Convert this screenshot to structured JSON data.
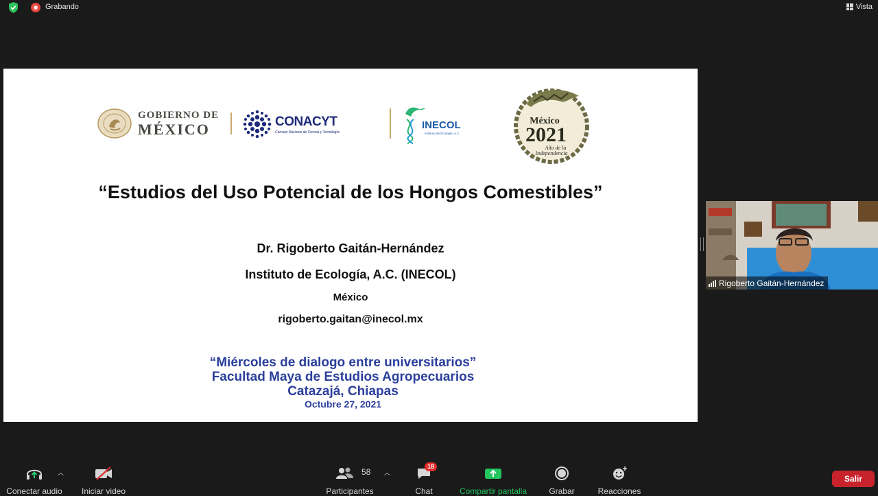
{
  "topbar": {
    "recording_label": "Grabando",
    "view_label": "Vista"
  },
  "slide": {
    "logos": {
      "gob_line1": "GOBIERNO DE",
      "gob_line2": "MÉXICO",
      "conacyt_name": "CONACYT",
      "conacyt_sub": "Consejo Nacional de Ciencia y Tecnología",
      "inecol_name": "INECOL",
      "inecol_sub": "Instituto de Ecología, A.C.",
      "mexico_2021_top": "México",
      "mexico_2021_year": "2021",
      "mexico_2021_sub1": "Año de la",
      "mexico_2021_sub2": "Independencia"
    },
    "title": "“Estudios del Uso Potencial de los Hongos Comestibles”",
    "author": "Dr. Rigoberto Gaitán-Hernández",
    "institution": "Instituto de Ecología, A.C. (INECOL)",
    "country": "México",
    "email": "rigoberto.gaitan@inecol.mx",
    "event_line1": "“Miércoles de dialogo entre universitarios”",
    "event_line2": "Facultad Maya de Estudios Agropecuarios",
    "event_line3": "Catazajá, Chiapas",
    "event_date": "Octubre 27, 2021"
  },
  "participant_video": {
    "name": "Rigoberto Gaitán-Hernández"
  },
  "toolbar": {
    "audio_label": "Conectar audio",
    "video_label": "Iniciar video",
    "participants_label": "Participantes",
    "participants_count": "58",
    "chat_label": "Chat",
    "chat_badge": "18",
    "share_label": "Compartir pantalla",
    "record_label": "Grabar",
    "reactions_label": "Reacciones",
    "leave_label": "Salir"
  },
  "colors": {
    "share_green": "#22c55e",
    "leave_red": "#c8232c",
    "slide_blue": "#2b3f9c",
    "recording_red": "#e8453c"
  }
}
